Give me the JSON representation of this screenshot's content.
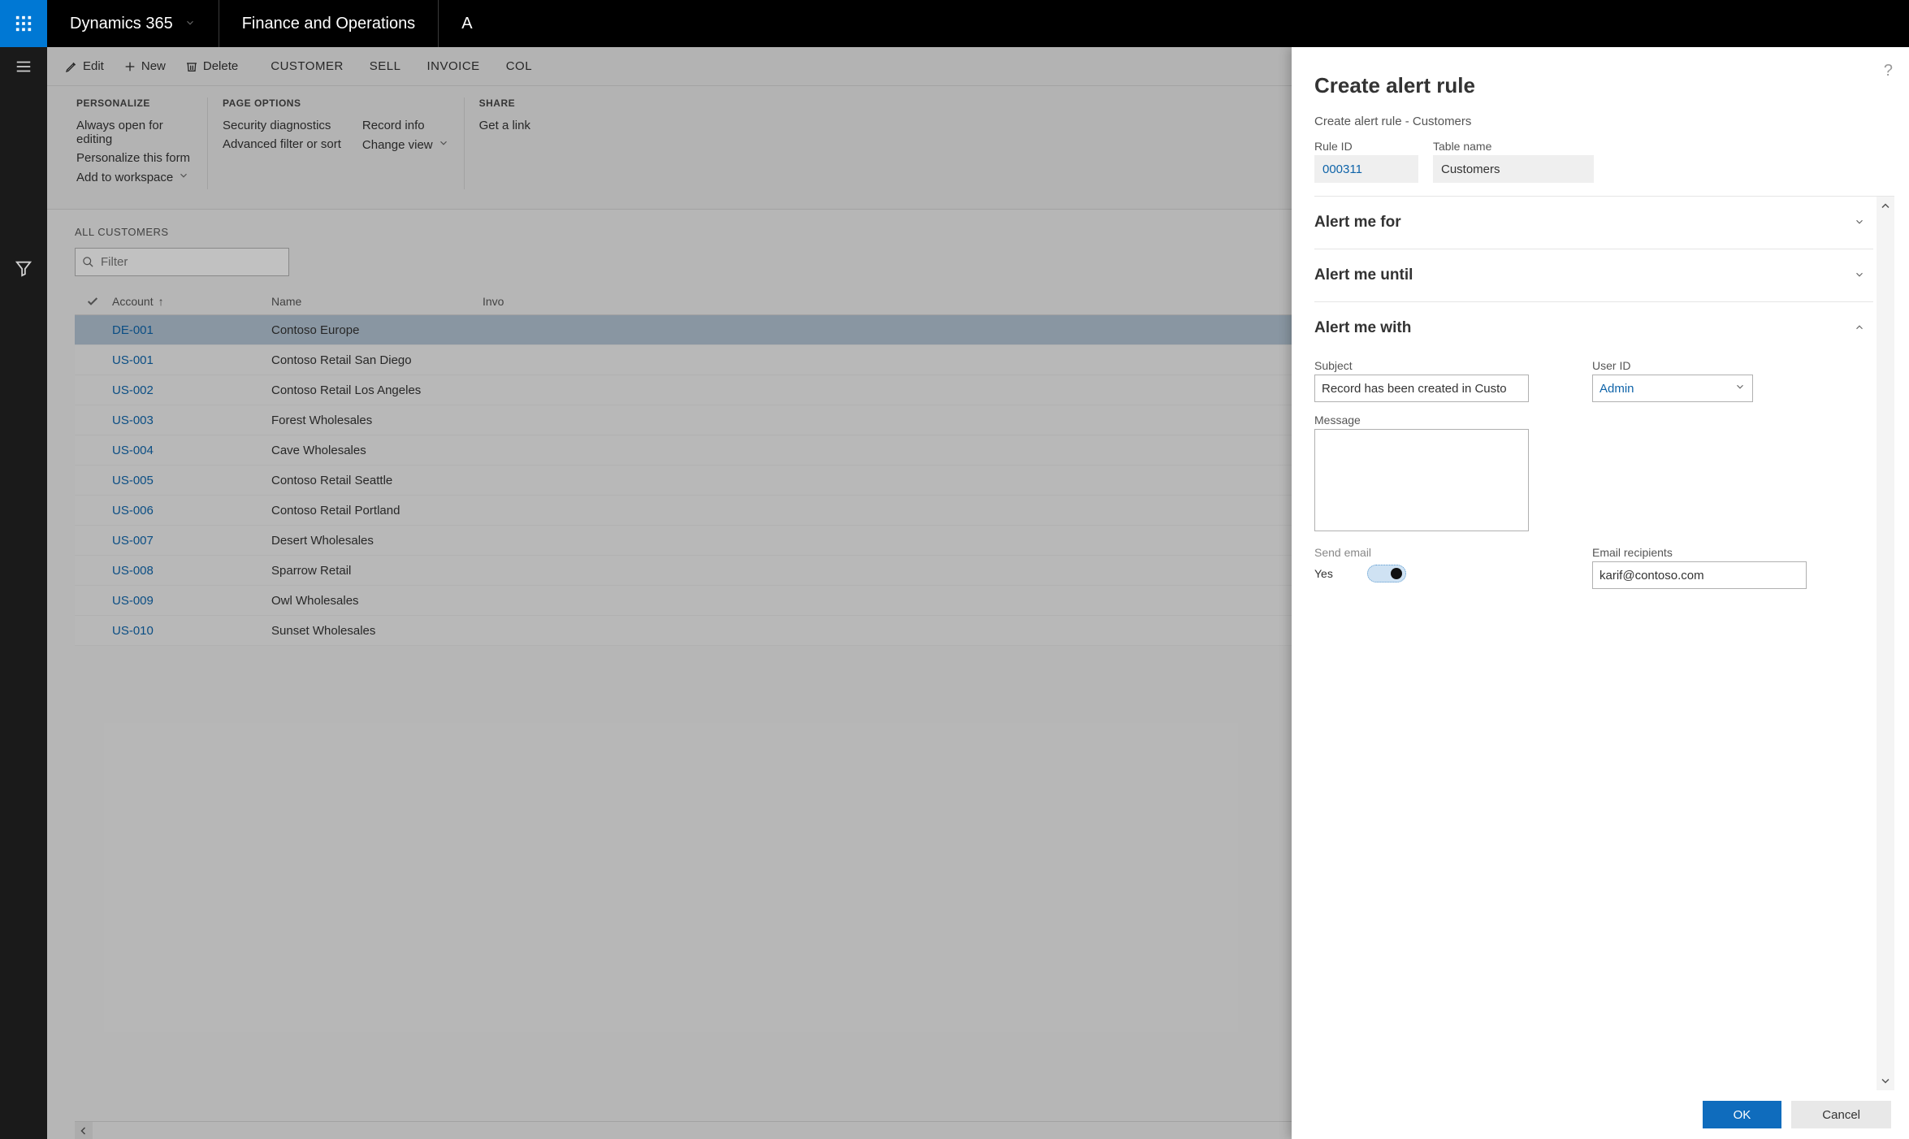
{
  "topnav": {
    "brand": "Dynamics 365",
    "module": "Finance and Operations"
  },
  "cmdbar": {
    "edit": "Edit",
    "new": "New",
    "delete": "Delete",
    "tabs": [
      "CUSTOMER",
      "SELL",
      "INVOICE",
      "COL"
    ]
  },
  "options": {
    "personalize": {
      "header": "PERSONALIZE",
      "items": [
        "Always open for editing",
        "Personalize this form",
        "Add to workspace"
      ]
    },
    "page": {
      "header": "PAGE OPTIONS",
      "items": [
        "Security diagnostics",
        "Advanced filter or sort"
      ],
      "items2": [
        "Record info",
        "Change view"
      ]
    },
    "share": {
      "header": "SHARE",
      "items": [
        "Get a link"
      ]
    }
  },
  "grid": {
    "title": "ALL CUSTOMERS",
    "filter_placeholder": "Filter",
    "columns": {
      "account": "Account",
      "name": "Name",
      "invoice": "Invo"
    },
    "rows": [
      {
        "account": "DE-001",
        "name": "Contoso Europe",
        "selected": true
      },
      {
        "account": "US-001",
        "name": "Contoso Retail San Diego"
      },
      {
        "account": "US-002",
        "name": "Contoso Retail Los Angeles"
      },
      {
        "account": "US-003",
        "name": "Forest Wholesales"
      },
      {
        "account": "US-004",
        "name": "Cave Wholesales"
      },
      {
        "account": "US-005",
        "name": "Contoso Retail Seattle"
      },
      {
        "account": "US-006",
        "name": "Contoso Retail Portland"
      },
      {
        "account": "US-007",
        "name": "Desert Wholesales"
      },
      {
        "account": "US-008",
        "name": "Sparrow Retail"
      },
      {
        "account": "US-009",
        "name": "Owl Wholesales"
      },
      {
        "account": "US-010",
        "name": "Sunset Wholesales"
      }
    ]
  },
  "panel": {
    "title": "Create alert rule",
    "subtitle": "Create alert rule - Customers",
    "rule_id_label": "Rule ID",
    "rule_id_value": "000311",
    "table_name_label": "Table name",
    "table_name_value": "Customers",
    "sections": {
      "for": "Alert me for",
      "until": "Alert me until",
      "with": "Alert me with"
    },
    "with": {
      "subject_label": "Subject",
      "subject_value": "Record has been created in Custo",
      "user_id_label": "User ID",
      "user_id_value": "Admin",
      "message_label": "Message",
      "message_value": "",
      "send_email_label": "Send email",
      "send_email_value": "Yes",
      "recipients_label": "Email recipients",
      "recipients_value": "karif@contoso.com"
    },
    "ok": "OK",
    "cancel": "Cancel"
  }
}
